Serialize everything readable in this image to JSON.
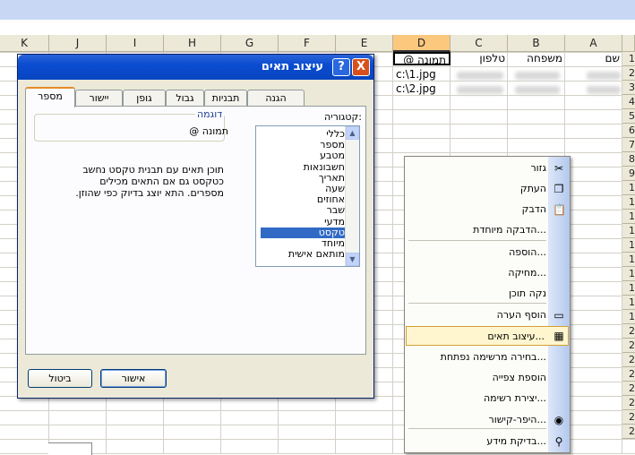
{
  "columns": [
    "K",
    "J",
    "I",
    "H",
    "G",
    "F",
    "E",
    "D",
    "C",
    "B",
    "A"
  ],
  "active_column": "D",
  "rows": [
    "1",
    "2",
    "3",
    "4",
    "5",
    "6",
    "7",
    "8",
    "9",
    "1",
    "1",
    "1",
    "1",
    "1",
    "1",
    "1",
    "1",
    "1",
    "1",
    "2",
    "2",
    "2",
    "2",
    "2",
    "2",
    "2",
    "2"
  ],
  "sheet": {
    "header_cells": {
      "d1": "תמונה @",
      "c1": "טלפון",
      "b1": "משפחה",
      "a1": "שם"
    },
    "d2": "c:\\1.jpg",
    "d3": "c:\\2.jpg"
  },
  "dialog": {
    "title": "עיצוב תאים",
    "help_button": "?",
    "close_button": "X",
    "tabs": [
      "מספר",
      "יישור",
      "גופן",
      "גבול",
      "תבניות",
      "הגנה"
    ],
    "selected_tab": "מספר",
    "category_label": "קטגוריה:",
    "categories": [
      "כללי",
      "מספר",
      "מטבע",
      "חשבונאות",
      "תאריך",
      "שעה",
      "אחוזים",
      "שבר",
      "מדעי",
      "טקסט",
      "מיוחד",
      "מותאם אישית"
    ],
    "selected_category": "טקסט",
    "sample_label": "דוגמה",
    "sample_value": "@ תמונה",
    "description": "תוכן תאים עם תבנית טקסט נחשב כטקסט גם אם התאים מכילים מספרים. התא יוצג בדיוק כפי שהוזן.",
    "ok_button": "אישור",
    "cancel_button": "ביטול"
  },
  "context_menu": {
    "items": [
      {
        "label": "גזור",
        "icon": "scissors-icon"
      },
      {
        "label": "העתק",
        "icon": "copy-icon"
      },
      {
        "label": "הדבק",
        "icon": "paste-icon"
      },
      {
        "label": "הדבקה מיוחדת...",
        "icon": ""
      },
      {
        "label": "הוספה...",
        "icon": ""
      },
      {
        "label": "מחיקה...",
        "icon": ""
      },
      {
        "label": "נקה תוכן",
        "icon": ""
      },
      {
        "label": "הוסף הערה",
        "icon": "comment-icon"
      },
      {
        "label": "עיצוב תאים...",
        "icon": "format-cells-icon"
      },
      {
        "label": "בחירה מרשימה נפתחת...",
        "icon": ""
      },
      {
        "label": "הוספת צפייה",
        "icon": ""
      },
      {
        "label": "יצירת רשימה...",
        "icon": ""
      },
      {
        "label": "היפר-קישור...",
        "icon": "hyperlink-icon"
      },
      {
        "label": "בדיקת מידע...",
        "icon": "research-icon"
      }
    ],
    "highlighted": "עיצוב תאים..."
  },
  "colors": {
    "title_bar": "#0a4cd0",
    "selection": "#316ac5",
    "menu_highlight": "#fff6cf",
    "active_header": "#fbc87e"
  }
}
